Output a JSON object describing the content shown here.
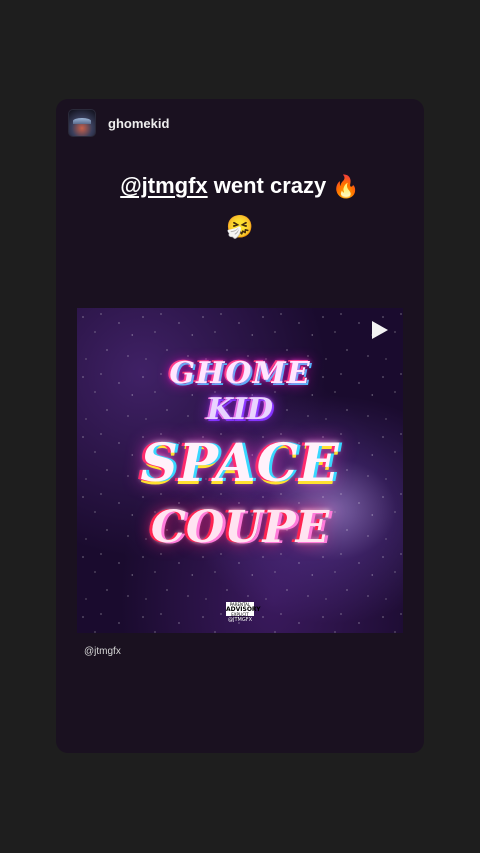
{
  "story": {
    "username": "ghomekid",
    "caption_mention": "@jtmgfx",
    "caption_rest": " went crazy",
    "fire_emoji": "🔥",
    "sneeze_emoji": "🤧",
    "credit": "@jtmgfx"
  },
  "cover": {
    "line1": "GHOME",
    "line2": "KID",
    "line3": "SPACE",
    "line4": "COUPE",
    "parental_small": "PARENTAL",
    "parental_big": "ADVISORY",
    "parental_foot": "EXPLICIT CONTENT",
    "credit": "@JTMGFX"
  },
  "icons": {
    "play": "play-icon",
    "fire": "fire-icon",
    "sneeze": "sneezing-face-icon"
  }
}
